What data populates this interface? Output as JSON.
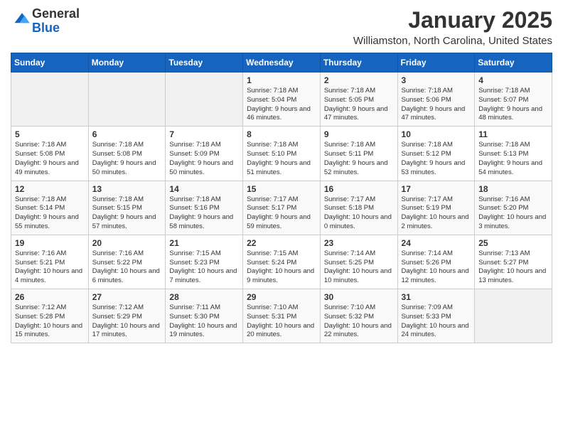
{
  "logo": {
    "general": "General",
    "blue": "Blue"
  },
  "title": "January 2025",
  "subtitle": "Williamston, North Carolina, United States",
  "weekdays": [
    "Sunday",
    "Monday",
    "Tuesday",
    "Wednesday",
    "Thursday",
    "Friday",
    "Saturday"
  ],
  "weeks": [
    [
      {
        "day": "",
        "sunrise": "",
        "sunset": "",
        "daylight": ""
      },
      {
        "day": "",
        "sunrise": "",
        "sunset": "",
        "daylight": ""
      },
      {
        "day": "",
        "sunrise": "",
        "sunset": "",
        "daylight": ""
      },
      {
        "day": "1",
        "sunrise": "Sunrise: 7:18 AM",
        "sunset": "Sunset: 5:04 PM",
        "daylight": "Daylight: 9 hours and 46 minutes."
      },
      {
        "day": "2",
        "sunrise": "Sunrise: 7:18 AM",
        "sunset": "Sunset: 5:05 PM",
        "daylight": "Daylight: 9 hours and 47 minutes."
      },
      {
        "day": "3",
        "sunrise": "Sunrise: 7:18 AM",
        "sunset": "Sunset: 5:06 PM",
        "daylight": "Daylight: 9 hours and 47 minutes."
      },
      {
        "day": "4",
        "sunrise": "Sunrise: 7:18 AM",
        "sunset": "Sunset: 5:07 PM",
        "daylight": "Daylight: 9 hours and 48 minutes."
      }
    ],
    [
      {
        "day": "5",
        "sunrise": "Sunrise: 7:18 AM",
        "sunset": "Sunset: 5:08 PM",
        "daylight": "Daylight: 9 hours and 49 minutes."
      },
      {
        "day": "6",
        "sunrise": "Sunrise: 7:18 AM",
        "sunset": "Sunset: 5:08 PM",
        "daylight": "Daylight: 9 hours and 50 minutes."
      },
      {
        "day": "7",
        "sunrise": "Sunrise: 7:18 AM",
        "sunset": "Sunset: 5:09 PM",
        "daylight": "Daylight: 9 hours and 50 minutes."
      },
      {
        "day": "8",
        "sunrise": "Sunrise: 7:18 AM",
        "sunset": "Sunset: 5:10 PM",
        "daylight": "Daylight: 9 hours and 51 minutes."
      },
      {
        "day": "9",
        "sunrise": "Sunrise: 7:18 AM",
        "sunset": "Sunset: 5:11 PM",
        "daylight": "Daylight: 9 hours and 52 minutes."
      },
      {
        "day": "10",
        "sunrise": "Sunrise: 7:18 AM",
        "sunset": "Sunset: 5:12 PM",
        "daylight": "Daylight: 9 hours and 53 minutes."
      },
      {
        "day": "11",
        "sunrise": "Sunrise: 7:18 AM",
        "sunset": "Sunset: 5:13 PM",
        "daylight": "Daylight: 9 hours and 54 minutes."
      }
    ],
    [
      {
        "day": "12",
        "sunrise": "Sunrise: 7:18 AM",
        "sunset": "Sunset: 5:14 PM",
        "daylight": "Daylight: 9 hours and 55 minutes."
      },
      {
        "day": "13",
        "sunrise": "Sunrise: 7:18 AM",
        "sunset": "Sunset: 5:15 PM",
        "daylight": "Daylight: 9 hours and 57 minutes."
      },
      {
        "day": "14",
        "sunrise": "Sunrise: 7:18 AM",
        "sunset": "Sunset: 5:16 PM",
        "daylight": "Daylight: 9 hours and 58 minutes."
      },
      {
        "day": "15",
        "sunrise": "Sunrise: 7:17 AM",
        "sunset": "Sunset: 5:17 PM",
        "daylight": "Daylight: 9 hours and 59 minutes."
      },
      {
        "day": "16",
        "sunrise": "Sunrise: 7:17 AM",
        "sunset": "Sunset: 5:18 PM",
        "daylight": "Daylight: 10 hours and 0 minutes."
      },
      {
        "day": "17",
        "sunrise": "Sunrise: 7:17 AM",
        "sunset": "Sunset: 5:19 PM",
        "daylight": "Daylight: 10 hours and 2 minutes."
      },
      {
        "day": "18",
        "sunrise": "Sunrise: 7:16 AM",
        "sunset": "Sunset: 5:20 PM",
        "daylight": "Daylight: 10 hours and 3 minutes."
      }
    ],
    [
      {
        "day": "19",
        "sunrise": "Sunrise: 7:16 AM",
        "sunset": "Sunset: 5:21 PM",
        "daylight": "Daylight: 10 hours and 4 minutes."
      },
      {
        "day": "20",
        "sunrise": "Sunrise: 7:16 AM",
        "sunset": "Sunset: 5:22 PM",
        "daylight": "Daylight: 10 hours and 6 minutes."
      },
      {
        "day": "21",
        "sunrise": "Sunrise: 7:15 AM",
        "sunset": "Sunset: 5:23 PM",
        "daylight": "Daylight: 10 hours and 7 minutes."
      },
      {
        "day": "22",
        "sunrise": "Sunrise: 7:15 AM",
        "sunset": "Sunset: 5:24 PM",
        "daylight": "Daylight: 10 hours and 9 minutes."
      },
      {
        "day": "23",
        "sunrise": "Sunrise: 7:14 AM",
        "sunset": "Sunset: 5:25 PM",
        "daylight": "Daylight: 10 hours and 10 minutes."
      },
      {
        "day": "24",
        "sunrise": "Sunrise: 7:14 AM",
        "sunset": "Sunset: 5:26 PM",
        "daylight": "Daylight: 10 hours and 12 minutes."
      },
      {
        "day": "25",
        "sunrise": "Sunrise: 7:13 AM",
        "sunset": "Sunset: 5:27 PM",
        "daylight": "Daylight: 10 hours and 13 minutes."
      }
    ],
    [
      {
        "day": "26",
        "sunrise": "Sunrise: 7:12 AM",
        "sunset": "Sunset: 5:28 PM",
        "daylight": "Daylight: 10 hours and 15 minutes."
      },
      {
        "day": "27",
        "sunrise": "Sunrise: 7:12 AM",
        "sunset": "Sunset: 5:29 PM",
        "daylight": "Daylight: 10 hours and 17 minutes."
      },
      {
        "day": "28",
        "sunrise": "Sunrise: 7:11 AM",
        "sunset": "Sunset: 5:30 PM",
        "daylight": "Daylight: 10 hours and 19 minutes."
      },
      {
        "day": "29",
        "sunrise": "Sunrise: 7:10 AM",
        "sunset": "Sunset: 5:31 PM",
        "daylight": "Daylight: 10 hours and 20 minutes."
      },
      {
        "day": "30",
        "sunrise": "Sunrise: 7:10 AM",
        "sunset": "Sunset: 5:32 PM",
        "daylight": "Daylight: 10 hours and 22 minutes."
      },
      {
        "day": "31",
        "sunrise": "Sunrise: 7:09 AM",
        "sunset": "Sunset: 5:33 PM",
        "daylight": "Daylight: 10 hours and 24 minutes."
      },
      {
        "day": "",
        "sunrise": "",
        "sunset": "",
        "daylight": ""
      }
    ]
  ]
}
